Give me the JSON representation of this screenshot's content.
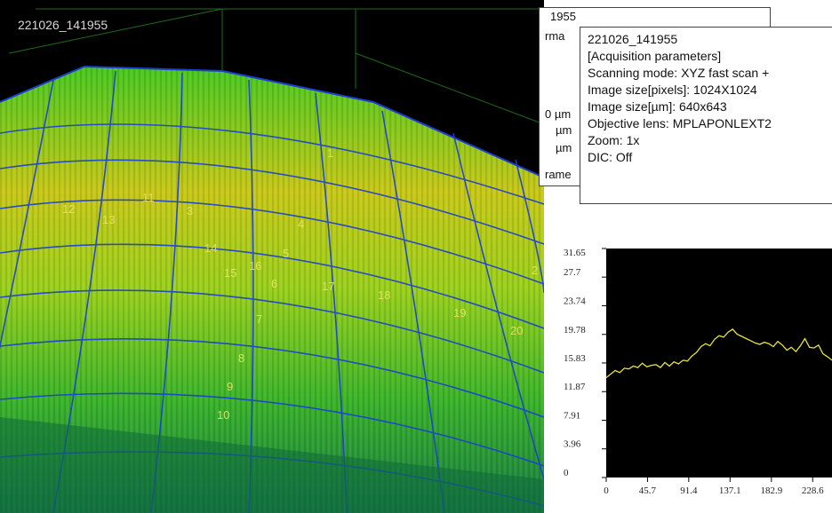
{
  "viewer": {
    "title": "221026_141955",
    "markers": [
      "1",
      "2",
      "3",
      "4",
      "5",
      "6",
      "7",
      "8",
      "9",
      "10",
      "11",
      "12",
      "13",
      "14",
      "15",
      "16",
      "17",
      "18",
      "19",
      "20"
    ],
    "colors": {
      "grid": "#1a3fd6",
      "surface_high": "#d4d414",
      "surface_mid": "#5ad21e",
      "surface_low": "#1e8c3c"
    }
  },
  "info_back": {
    "title": "1955",
    "fragments": [
      "rma",
      "0 µm",
      "µm",
      "µm",
      "rame"
    ]
  },
  "tooltip": {
    "lines": [
      "221026_141955",
      "[Acquisition parameters]",
      "Scanning mode: XYZ fast scan +",
      "Image size[pixels]: 1024X1024",
      "Image size[µm]: 640x643",
      "Objective lens: MPLAPONLEXT2",
      "Zoom: 1x",
      "DIC: Off"
    ]
  },
  "chart_data": {
    "type": "line",
    "y_ticks": [
      "0",
      "3.96",
      "7.91",
      "11.87",
      "15.83",
      "19.78",
      "23.74",
      "27.7",
      "31.65"
    ],
    "x_ticks": [
      "0",
      "45.7",
      "91.4",
      "137.1",
      "182.9",
      "228.6"
    ],
    "ylim": [
      0,
      31.65
    ],
    "xlim": [
      0,
      250
    ],
    "line_color": "#e8e23a",
    "background": "#000000",
    "series": [
      {
        "x": [
          0,
          5,
          10,
          15,
          20,
          25,
          30,
          35,
          40,
          45,
          50,
          55,
          60,
          65,
          70,
          75,
          80,
          85,
          90,
          95,
          100,
          105,
          110,
          115,
          120,
          125,
          130,
          135,
          140,
          145,
          150,
          155,
          160,
          165,
          170,
          175,
          180,
          185,
          190,
          195,
          200,
          205,
          210,
          215,
          220,
          225,
          230,
          235,
          240,
          245,
          250
        ],
        "values": [
          13.8,
          14.3,
          14.8,
          14.5,
          15.1,
          15.0,
          15.4,
          15.2,
          15.8,
          15.3,
          15.5,
          15.6,
          15.2,
          15.9,
          15.4,
          16.0,
          15.7,
          16.2,
          16.1,
          16.8,
          17.3,
          18.1,
          18.5,
          18.2,
          19.1,
          19.6,
          19.4,
          20.1,
          20.5,
          19.8,
          19.5,
          19.2,
          18.9,
          18.6,
          18.4,
          18.7,
          18.5,
          18.1,
          18.8,
          18.3,
          17.6,
          18.0,
          17.4,
          18.2,
          19.2,
          18.0,
          17.9,
          18.3,
          17.1,
          16.7,
          16.2
        ]
      }
    ]
  }
}
